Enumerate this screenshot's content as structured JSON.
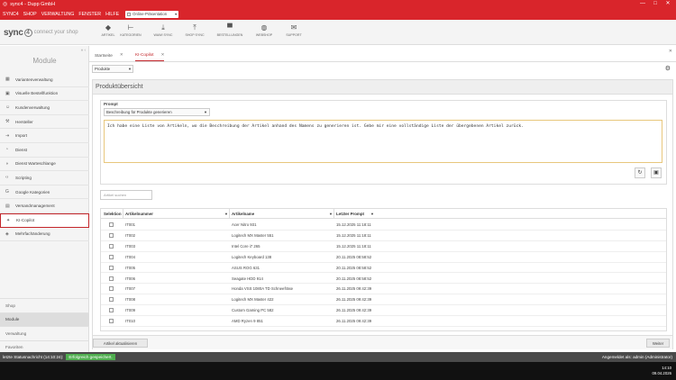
{
  "window": {
    "title": "sync4 - Dupp GmbH",
    "minimize": "—",
    "maximize": "□",
    "close": "✕"
  },
  "menu": {
    "items": [
      "SYNC4",
      "SHOP",
      "VERWALTUNG",
      "FENSTER",
      "HILFE"
    ],
    "shop_select": "Online-Präsentation"
  },
  "logo": {
    "name": "sync",
    "badge": "4",
    "tagline": "connect your shop"
  },
  "toolbar": [
    {
      "label": "ARTIKEL",
      "icon": "tag-icon",
      "glyph": "◆"
    },
    {
      "label": "KATEGORIEN",
      "icon": "hierarchy-icon",
      "glyph": "⊢"
    },
    {
      "label": "WAWI SYNC",
      "icon": "download-icon",
      "glyph": "⤓"
    },
    {
      "label": "SHOP SYNC",
      "icon": "upload-icon",
      "glyph": "⤒"
    },
    {
      "label": "BESTELLUNGEN",
      "icon": "cart-icon",
      "glyph": "▀"
    },
    {
      "label": "WEBSHOP",
      "icon": "globe-icon",
      "glyph": "◍"
    },
    {
      "label": "SUPPORT",
      "icon": "mail-icon",
      "glyph": "✉"
    }
  ],
  "sidebar": {
    "collapse": "«  ‹",
    "header": "Module",
    "items": [
      {
        "label": "Variantenverwaltung",
        "icon": "grid-icon",
        "glyph": "▦"
      },
      {
        "label": "Visuelle Bestellfunktion",
        "icon": "image-icon",
        "glyph": "▣"
      },
      {
        "label": "Kundenverwaltung",
        "icon": "user-icon",
        "glyph": "☺"
      },
      {
        "label": "Hersteller",
        "icon": "hammer-icon",
        "glyph": "⚒"
      },
      {
        "label": "Import",
        "icon": "import-icon",
        "glyph": "⇥"
      },
      {
        "label": "Dienst",
        "icon": "service-icon",
        "glyph": "◔"
      },
      {
        "label": "Dienst Warteschlange",
        "icon": "queue-icon",
        "glyph": "◑"
      },
      {
        "label": "Scripting",
        "icon": "code-icon",
        "glyph": "‹›"
      },
      {
        "label": "Google Kategorien",
        "icon": "google-icon",
        "glyph": "G"
      },
      {
        "label": "Versandmanagement",
        "icon": "box-icon",
        "glyph": "▤"
      },
      {
        "label": "KI-Copilot",
        "icon": "robot-icon",
        "glyph": "✦"
      },
      {
        "label": "Mehrfachänderung",
        "icon": "edit-multiple-icon",
        "glyph": "◈"
      }
    ],
    "groups": [
      "Shop",
      "Module",
      "Verwaltung",
      "Favoriten"
    ]
  },
  "tabs": {
    "items": [
      {
        "label": "Startseite",
        "close": "✕"
      },
      {
        "label": "KI-Copilot",
        "close": "✕"
      }
    ],
    "close_all": "✕"
  },
  "view_select": "Produkte",
  "panel": {
    "title": "Produktübersicht",
    "prompt_label": "Prompt",
    "prompt_select": "Beschreibung für Produkte generieren",
    "prompt_text": "Ich habe eine Liste von Artikeln, wo die Beschreibung der Artikel anhand des Namens zu generieren ist. Gebe mir eine vollständige Liste der übergebenen Artikel zurück.",
    "refresh_glyph": "↻",
    "save_glyph": "▣",
    "search_placeholder": "Artikel suchen",
    "columns": [
      "Selektion",
      "Artikelnummer",
      "Artikelname",
      "Letzter Prompt"
    ],
    "filter_glyph": "▼",
    "rows": [
      {
        "nr": "IT001",
        "name": "Acer Nitro 931",
        "date": "15.12.2025 11:18:11"
      },
      {
        "nr": "IT002",
        "name": "Logitech MX Master 551",
        "date": "15.12.2025 11:18:11"
      },
      {
        "nr": "IT003",
        "name": "Intel Core i7 265",
        "date": "15.12.2025 11:18:11"
      },
      {
        "nr": "IT004",
        "name": "Logitech Keyboard 138",
        "date": "20.11.2025 08:58:52"
      },
      {
        "nr": "IT005",
        "name": "ASUS ROG 631",
        "date": "20.11.2025 08:58:52"
      },
      {
        "nr": "IT006",
        "name": "Seagate HDD 914",
        "date": "20.11.2025 08:58:52"
      },
      {
        "nr": "IT007",
        "name": "Honda VSS 1080A TD Schneefräse",
        "date": "26.11.2025 09:42:39"
      },
      {
        "nr": "IT008",
        "name": "Logitech MX Master 422",
        "date": "26.11.2025 09:42:39"
      },
      {
        "nr": "IT009",
        "name": "Custom Gaming PC 582",
        "date": "26.11.2025 09:42:39"
      },
      {
        "nr": "IT010",
        "name": "AMD Ryzen 9 851",
        "date": "26.11.2025 09:42:39"
      }
    ],
    "update_button": "Artikel aktualisieren",
    "next_button": "Weiter"
  },
  "settings_glyph": "⚙",
  "status": {
    "label": "letzte Statusnachricht (14:10:24):",
    "message": "Erfolgreich gespeichert.",
    "user": "Angemeldet als: admin (Administrator)"
  },
  "taskbar": {
    "time": "14:10",
    "date": "09.04.2026"
  }
}
